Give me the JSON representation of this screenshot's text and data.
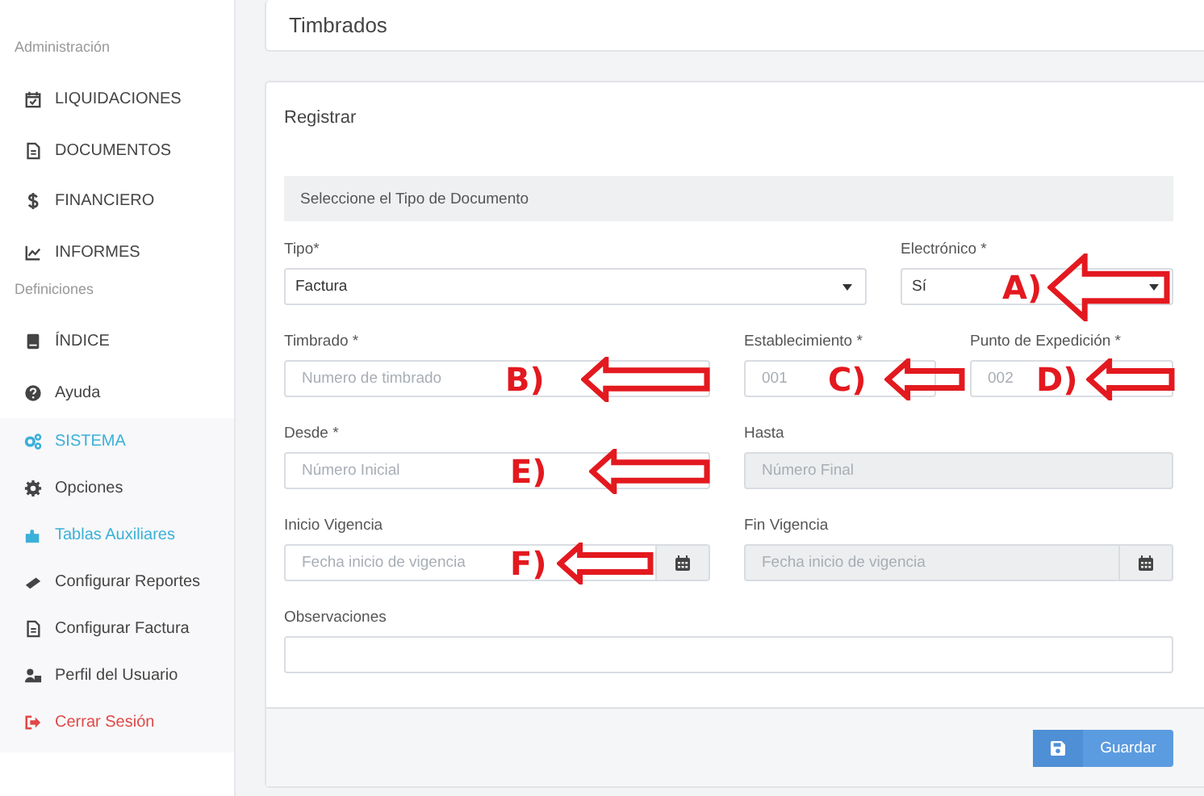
{
  "sidebar": {
    "sections": [
      {
        "title": "Administración",
        "items": [
          {
            "label": "LIQUIDACIONES",
            "color": "#444444"
          },
          {
            "label": "DOCUMENTOS",
            "color": "#444444"
          },
          {
            "label": "FINANCIERO",
            "color": "#444444"
          },
          {
            "label": "INFORMES",
            "color": "#444444"
          }
        ]
      },
      {
        "title": "Definiciones",
        "items": [
          {
            "label": "ÍNDICE",
            "color": "#444444"
          },
          {
            "label": "Ayuda",
            "color": "#444444"
          },
          {
            "label": "SISTEMA",
            "color": "#3bb0d8",
            "expanded": true,
            "children": [
              {
                "label": "Opciones",
                "color": "#444444"
              },
              {
                "label": "Tablas Auxiliares",
                "color": "#3bb0d8"
              },
              {
                "label": "Configurar Reportes",
                "color": "#444444"
              },
              {
                "label": "Configurar Factura",
                "color": "#444444"
              },
              {
                "label": "Perfil del Usuario",
                "color": "#444444"
              },
              {
                "label": "Cerrar Sesión",
                "color": "#e04848"
              }
            ]
          }
        ]
      }
    ]
  },
  "header": {
    "title": "Timbrados"
  },
  "form": {
    "title": "Registrar",
    "section": "Seleccione el Tipo de Documento",
    "rows": [
      [
        {
          "kind": "select",
          "label": "Tipo*",
          "value": "Factura",
          "disabled": false
        },
        {
          "kind": "select",
          "label": "Electrónico *",
          "value": "Sí",
          "disabled": false,
          "annotation": "A)"
        }
      ],
      [
        {
          "kind": "text",
          "label": "Timbrado *",
          "placeholder": "Numero de timbrado",
          "disabled": false,
          "annotation": "B)"
        },
        {
          "kind": "text",
          "label": "Establecimiento *",
          "placeholder": "001",
          "disabled": false,
          "annotation": "C)"
        },
        {
          "kind": "text",
          "label": "Punto de Expedición *",
          "placeholder": "002",
          "disabled": false,
          "annotation": "D)"
        }
      ],
      [
        {
          "kind": "text",
          "label": "Desde *",
          "placeholder": "Número Inicial",
          "disabled": false,
          "annotation": "E)"
        },
        {
          "kind": "text",
          "label": "Hasta",
          "placeholder": "Número Final",
          "disabled": true
        }
      ],
      [
        {
          "kind": "date",
          "label": "Inicio Vigencia",
          "placeholder": "Fecha inicio de vigencia",
          "disabled": false,
          "annotation": "F)"
        },
        {
          "kind": "date",
          "label": "Fin Vigencia",
          "placeholder": "Fecha inicio de vigencia",
          "disabled": true
        }
      ],
      [
        {
          "kind": "text",
          "label": "Observaciones",
          "disabled": false
        }
      ]
    ],
    "button": {
      "label": "Guardar"
    }
  }
}
